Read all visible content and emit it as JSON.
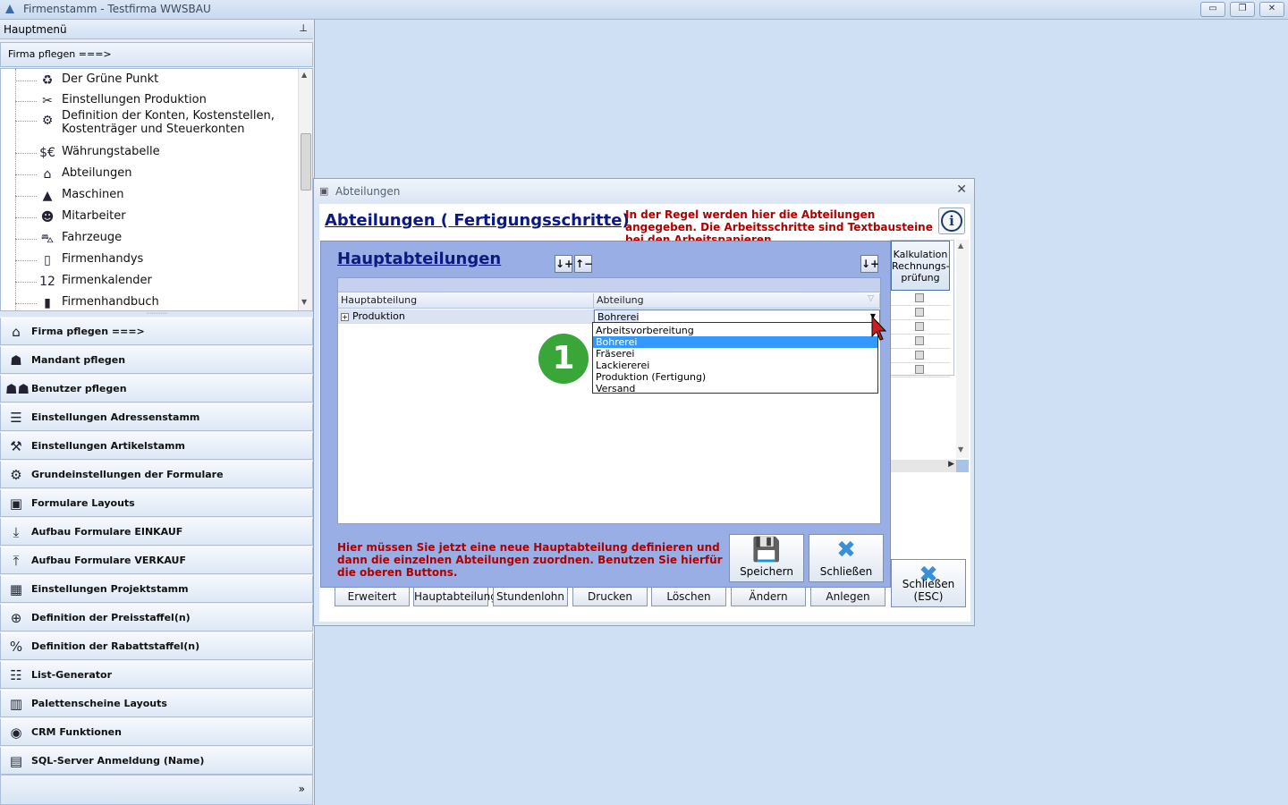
{
  "titlebar": {
    "title": "Firmenstamm - Testfirma WWSBAU",
    "minimize": "▭",
    "restore": "❐",
    "close": "✕"
  },
  "left": {
    "menu_title": "Hauptmenü",
    "pin": "⊥",
    "firma_row": "Firma pflegen   ===>",
    "tree_items": [
      {
        "label": "Der Grüne Punkt",
        "icon": "recycle-icon",
        "glyph": "♻"
      },
      {
        "label": "Einstellungen Produktion",
        "icon": "tools-icon",
        "glyph": "✂"
      },
      {
        "label": "Definition der Konten, Kostenstellen, Kostenträger und Steuerkonten",
        "icon": "coins-icon",
        "glyph": "⚙"
      },
      {
        "label": "Währungstabelle",
        "icon": "currency-icon",
        "glyph": "$€"
      },
      {
        "label": "Abteilungen",
        "icon": "department-icon",
        "glyph": "⌂"
      },
      {
        "label": "Maschinen",
        "icon": "machine-icon",
        "glyph": "▲"
      },
      {
        "label": "Mitarbeiter",
        "icon": "worker-icon",
        "glyph": "☻"
      },
      {
        "label": "Fahrzeuge",
        "icon": "car-icon",
        "glyph": "⛍"
      },
      {
        "label": "Firmenhandys",
        "icon": "phone-icon",
        "glyph": "▯"
      },
      {
        "label": "Firmenkalender",
        "icon": "calendar-icon",
        "glyph": "12"
      },
      {
        "label": "Firmenhandbuch",
        "icon": "book-icon",
        "glyph": "▮"
      }
    ],
    "nav_items": [
      {
        "label": "Firma pflegen   ===>",
        "icon": "factory-icon",
        "glyph": "⌂"
      },
      {
        "label": "Mandant pflegen",
        "icon": "user-icon",
        "glyph": "☗"
      },
      {
        "label": "Benutzer pflegen",
        "icon": "users-icon",
        "glyph": "☗☗"
      },
      {
        "label": "Einstellungen Adressenstamm",
        "icon": "address-icon",
        "glyph": "☰"
      },
      {
        "label": "Einstellungen Artikelstamm",
        "icon": "article-icon",
        "glyph": "⚒"
      },
      {
        "label": "Grundeinstellungen der Formulare",
        "icon": "form-settings-icon",
        "glyph": "⚙"
      },
      {
        "label": "Formulare Layouts",
        "icon": "form-layout-icon",
        "glyph": "▣"
      },
      {
        "label": "Aufbau Formulare EINKAUF",
        "icon": "download-icon",
        "glyph": "⤓"
      },
      {
        "label": "Aufbau Formulare VERKAUF",
        "icon": "upload-icon",
        "glyph": "⤒"
      },
      {
        "label": "Einstellungen Projektstamm",
        "icon": "project-icon",
        "glyph": "▦"
      },
      {
        "label": "Definition der Preisstaffel(n)",
        "icon": "price-icon",
        "glyph": "⊕"
      },
      {
        "label": "Definition der Rabattstaffel(n)",
        "icon": "discount-icon",
        "glyph": "%"
      },
      {
        "label": "List-Generator",
        "icon": "list-icon",
        "glyph": "☷"
      },
      {
        "label": "Palettenscheine Layouts",
        "icon": "pallet-icon",
        "glyph": "▥"
      },
      {
        "label": "CRM Funktionen",
        "icon": "crm-icon",
        "glyph": "◉"
      },
      {
        "label": "SQL-Server Anmeldung (Name)",
        "icon": "server-icon",
        "glyph": "▤"
      }
    ],
    "expand": "»"
  },
  "window": {
    "title": "Abteilungen",
    "heading": "Abteilungen ( Fertigungsschritte)",
    "hint": "In der Regel werden hier die Abteilungen angegeben. Die Arbeitsschritte sind Textbausteine bei den Arbeitspapieren.",
    "info": "i",
    "column_header": "Kalkulation Rechnungs-prüfung",
    "bottom_buttons": [
      "Erweitert",
      "Hauptabteilung",
      "Stundenlohn",
      "Drucken",
      "Löschen",
      "Ändern",
      "Anlegen"
    ],
    "close_esc": "Schließen (ESC)"
  },
  "dialog": {
    "title": "Hauptabteilungen",
    "col_hauptabteilung": "Hauptabteilung",
    "col_abteilung": "Abteilung",
    "row_hauptabteilung": "Produktion",
    "row_abteilung": "Bohrerei",
    "dropdown_options": [
      "Arbeitsvorbereitung",
      "Bohrerei",
      "Fräserei",
      "Lackiererei",
      "Produktion (Fertigung)",
      "Versand"
    ],
    "selected_option": "Bohrerei",
    "marker": "1",
    "note": "Hier müssen Sie jetzt eine neue Hauptabteilung definieren und dann die einzelnen Abteilungen zuordnen. Benutzen Sie hierfür die oberen Buttons.",
    "save": "Speichern",
    "close": "Schließen"
  }
}
